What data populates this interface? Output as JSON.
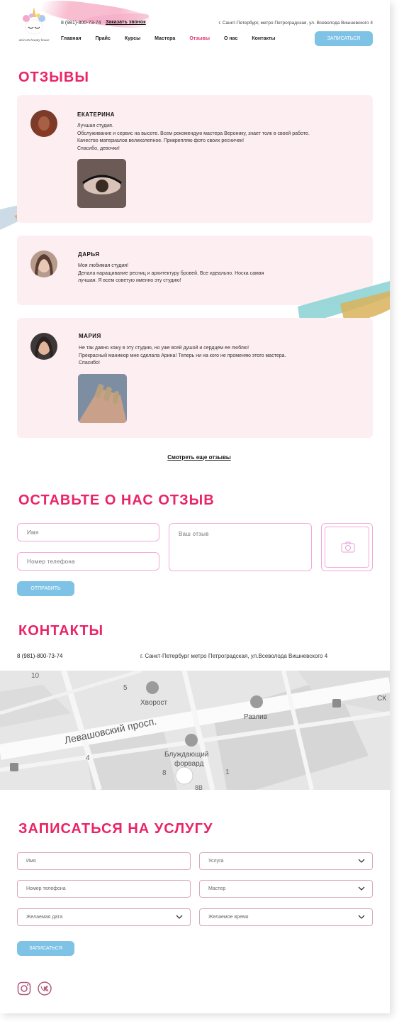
{
  "header": {
    "logo_text": "unicorn beauty house",
    "phone": "8 (981)-800-73-74",
    "callback_label": "Заказать звонок",
    "address": "г. Санкт-Петербург, метро Петроградская, ул. Всеволода Вишневского 4",
    "nav": [
      "Главная",
      "Прайс",
      "Курсы",
      "Мастера",
      "Отзывы",
      "О нас",
      "Контакты"
    ],
    "nav_active_index": 4,
    "book_button": "ЗАПИСАТЬСЯ"
  },
  "reviews": {
    "title": "ОТЗЫВЫ",
    "items": [
      {
        "name": "ЕКАТЕРИНА",
        "lines": [
          "Лучшая студия.",
          "Обслуживание и сервис на высоте. Всем рекомендую мастера Веронику, знает толк в своей работе.",
          "Качество материалов великолепное. Прикрепляю фото своих ресничек!",
          "Спасибо, девочки!"
        ],
        "has_photo": true
      },
      {
        "name": "ДАРЬЯ",
        "lines": [
          "Моя любимая студия!",
          "Делала наращивание ресниц и архитектуру бровей. Все идеально. Носка самая",
          "лучшая. Я всем советую именно эту студию!"
        ],
        "has_photo": false
      },
      {
        "name": "МАРИЯ",
        "lines": [
          "Не так давно хожу в эту студию, но уже всей душой и сердцем ее люблю!",
          "Прекрасный маникюр мне сделала Арина! Теперь ни на кого не променяю этого мастера.",
          "Спасибо!"
        ],
        "has_photo": true
      }
    ],
    "more_link": "Смотреть еще отзывы"
  },
  "review_form": {
    "title": "ОСТАВЬТЕ О НАС ОТЗЫВ",
    "name_placeholder": "Имя",
    "phone_placeholder": "Номер телефона",
    "review_placeholder": "Ваш отзыв",
    "photo_icon": "camera-icon",
    "submit_label": "ОТПРАВИТЬ"
  },
  "contacts": {
    "title": "КОНТАКТЫ",
    "phone": "8 (981)-800-73-74",
    "address": "г. Санкт-Петербург метро Петроградская, ул.Всеволода Вишневского 4"
  },
  "map": {
    "labels": {
      "street": "Левашовский просп.",
      "place1": "Хворост",
      "place2": "Разлив",
      "place3a": "Блуждающий",
      "place3b": "форвард",
      "n10": "10",
      "n5": "5",
      "n4": "4",
      "n8": "8",
      "n1": "1",
      "n8b": "8В",
      "edge": "СК"
    }
  },
  "booking": {
    "title": "ЗАПИСАТЬСЯ НА УСЛУГУ",
    "name_placeholder": "Имя",
    "phone_placeholder": "Номер телефона",
    "date_placeholder": "Желаемая дата",
    "service_placeholder": "Услуга",
    "master_placeholder": "Мастер",
    "time_placeholder": "Желаемое время",
    "submit_label": "ЗАПИСАТЬСЯ"
  },
  "social": [
    "instagram-icon",
    "vk-icon"
  ],
  "colors": {
    "accent": "#ea2465",
    "button": "#7ec3e6",
    "card_bg": "#fdeef2",
    "field_border": "#f3a9d9"
  }
}
